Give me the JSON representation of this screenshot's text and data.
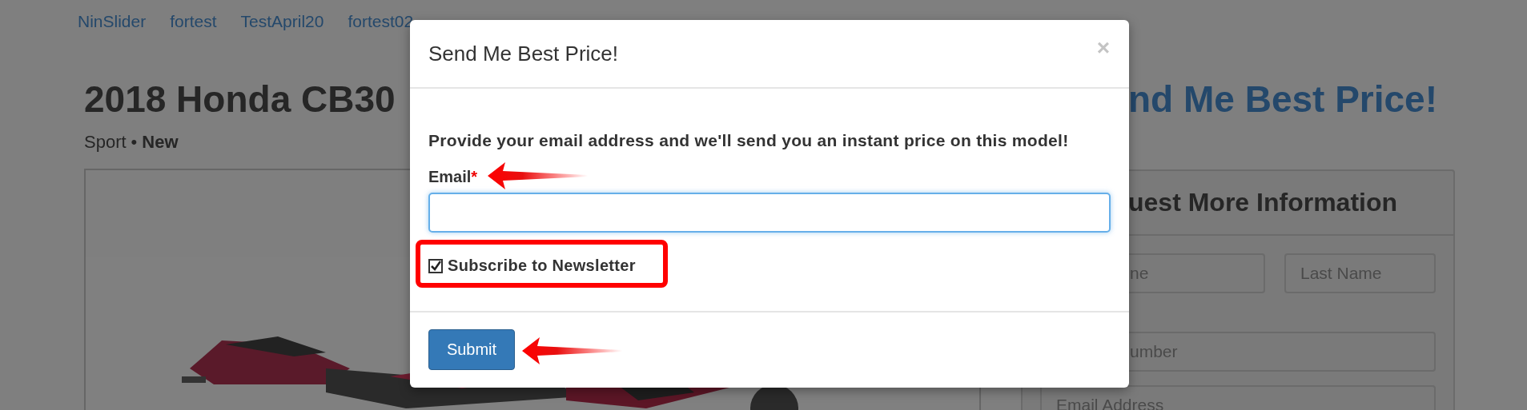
{
  "nav": {
    "links": [
      "NinSlider",
      "fortest",
      "TestApril20",
      "fortest02"
    ]
  },
  "product": {
    "title": "2018 Honda CB30",
    "category": "Sport",
    "separator": "•",
    "condition": "New"
  },
  "side": {
    "heading": "nd Me Best Price!",
    "panel_title": "uest More Information",
    "field_rows": [
      [
        "ne",
        "Last Name"
      ],
      [
        "umber"
      ],
      [
        "Email Address"
      ]
    ]
  },
  "modal": {
    "title": "Send Me Best Price!",
    "close": "×",
    "intro": "Provide your email address and we'll send you an instant price on this model!",
    "email_label": "Email",
    "required_mark": "*",
    "subscribe": {
      "label": "Subscribe to Newsletter",
      "checked": true
    },
    "submit": "Submit"
  }
}
